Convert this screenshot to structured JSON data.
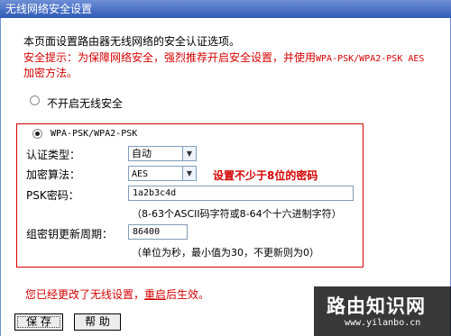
{
  "title": "无线网络安全设置",
  "intro": "本页面设置路由器无线网络的安全认证选项。",
  "warning": {
    "prefix": "安全提示：为保障网络安全，强烈推荐开启安全设置，并使用",
    "mode": "WPA-PSK/WPA2-PSK AES",
    "suffix": "加密方法。"
  },
  "options": {
    "none_label": "不开启无线安全",
    "wpa_label": "WPA-PSK/WPA2-PSK",
    "selected": "WPA-PSK/WPA2-PSK"
  },
  "form": {
    "auth_type_label": "认证类型：",
    "auth_type_value": "自动",
    "encryption_label": "加密算法：",
    "encryption_value": "AES",
    "psk_label": "PSK密码：",
    "psk_value": "1a2b3c4d",
    "psk_hint": "（8-63个ASCII码字符或8-64个十六进制字符）",
    "rekey_label": "组密钥更新周期：",
    "rekey_value": "86400",
    "rekey_hint": "（单位为秒，最小值为30，不更新则为0）"
  },
  "annotation": "设置不少于8位的密码",
  "status": {
    "text": "您已经更改了无线设置，",
    "link": "重启",
    "suffix": "后生效。"
  },
  "buttons": {
    "save": "保 存",
    "help": "帮 助"
  },
  "watermark": {
    "name": "路由知识网",
    "url": "www.yilanbo.cn"
  },
  "colors": {
    "title_bar": "#2f5bb7",
    "warning": "#d40000"
  }
}
